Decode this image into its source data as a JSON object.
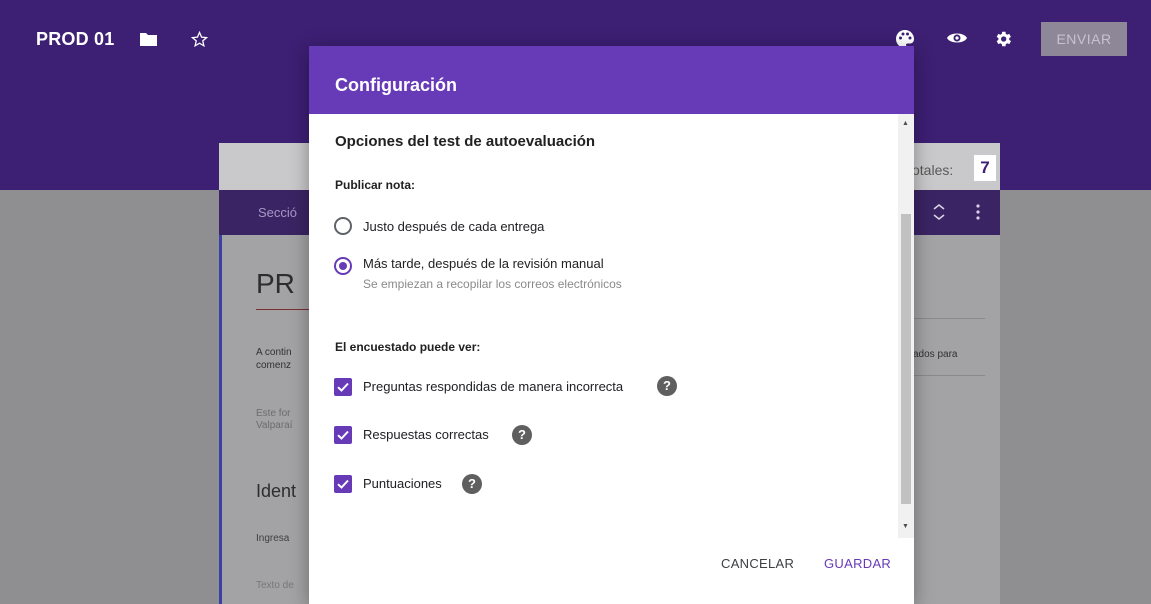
{
  "app": {
    "title": "PROD 01",
    "send_label": "ENVIAR",
    "totals_label": "otales:",
    "totals_value": "7",
    "colors": {
      "header": "#3d1f73",
      "accent": "#673ab7"
    }
  },
  "form": {
    "section_label": "Secció",
    "title": "PR",
    "desc_line1": "A contin",
    "desc_line2": "comenz",
    "note_line1": "Este for",
    "note_line2": "Valparaí",
    "ident": "Ident",
    "ingresa": "Ingresa",
    "texto": "Texto de",
    "right_text": "ados para"
  },
  "dialog": {
    "title": "Configuración",
    "options_title": "Opciones del test de autoevaluación",
    "publish_label": "Publicar nota:",
    "radio_options": [
      {
        "label": "Justo después de cada entrega",
        "checked": false
      },
      {
        "label": "Más tarde, después de la revisión manual",
        "sublabel": "Se empiezan a recopilar los correos electrónicos",
        "checked": true
      }
    ],
    "see_label": "El encuestado puede ver:",
    "checkbox_options": [
      {
        "label": "Preguntas respondidas de manera incorrecta",
        "checked": true
      },
      {
        "label": "Respuestas correctas",
        "checked": true
      },
      {
        "label": "Puntuaciones",
        "checked": true
      }
    ],
    "help_glyph": "?",
    "scroll_up_glyph": "▲",
    "scroll_down_glyph": "▼",
    "cancel_label": "CANCELAR",
    "save_label": "GUARDAR"
  },
  "icons": [
    "folder-icon",
    "star-icon",
    "palette-icon",
    "eye-icon",
    "gear-icon",
    "collapse-icon",
    "more-vert-icon",
    "help-icon",
    "check-icon"
  ]
}
